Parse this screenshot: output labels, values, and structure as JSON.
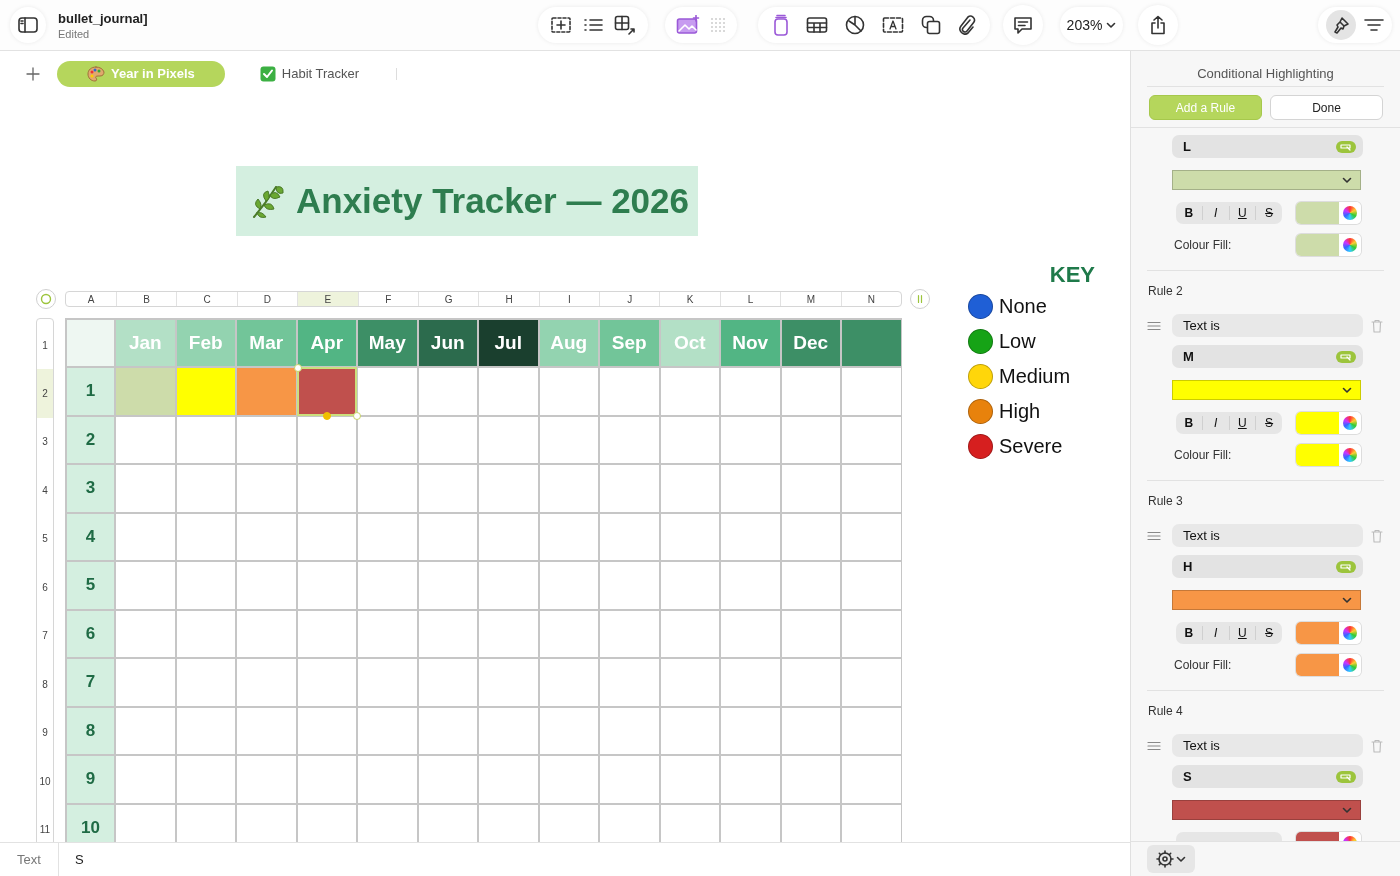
{
  "document": {
    "title": "bullet_journal]",
    "status": "Edited"
  },
  "toolbar": {
    "zoom": "203%"
  },
  "sheet_tabs": [
    {
      "label": "Year in Pixels",
      "selected": true,
      "kind": "palette"
    },
    {
      "label": "Habit Tracker",
      "selected": false,
      "kind": "check"
    }
  ],
  "banner": {
    "title": "Anxiety Tracker — 2026"
  },
  "table": {
    "column_letters": [
      "A",
      "B",
      "C",
      "D",
      "E",
      "F",
      "G",
      "H",
      "I",
      "J",
      "K",
      "L",
      "M",
      "N"
    ],
    "row_numbers": [
      "1",
      "2",
      "3",
      "4",
      "5",
      "6",
      "7",
      "8",
      "9",
      "10",
      "11"
    ],
    "header_cells": [
      {
        "color": "#eef7f2"
      },
      {
        "label": "Jan",
        "color": "#b3e0c6"
      },
      {
        "label": "Feb",
        "color": "#93d3b0"
      },
      {
        "label": "Mar",
        "color": "#72c599"
      },
      {
        "label": "Apr",
        "color": "#52b584"
      },
      {
        "label": "May",
        "color": "#3d8f66"
      },
      {
        "label": "Jun",
        "color": "#2c6b4d"
      },
      {
        "label": "Jul",
        "color": "#1a3f2e"
      },
      {
        "label": "Aug",
        "color": "#93d3b0"
      },
      {
        "label": "Sep",
        "color": "#72c599"
      },
      {
        "label": "Oct",
        "color": "#b3e0c6"
      },
      {
        "label": "Nov",
        "color": "#52b584"
      },
      {
        "label": "Dec",
        "color": "#3d8f66"
      },
      {
        "color": "#3d8f66"
      }
    ],
    "rows": [
      {
        "day": "1",
        "cells": [
          {
            "color": "#cddcaa",
            "selected": false
          },
          {
            "color": "#ffff00",
            "selected": false
          },
          {
            "color": "#f79646",
            "selected": false
          },
          {
            "color": "#c0504d",
            "selected": true
          }
        ]
      },
      {
        "day": "2"
      },
      {
        "day": "3"
      },
      {
        "day": "4"
      },
      {
        "day": "5"
      },
      {
        "day": "6"
      },
      {
        "day": "7"
      },
      {
        "day": "8"
      },
      {
        "day": "9"
      },
      {
        "day": "10"
      }
    ]
  },
  "key": {
    "title": "KEY",
    "items": [
      {
        "label": "None",
        "color": "#1f5fd6"
      },
      {
        "label": "Low",
        "color": "#16a316"
      },
      {
        "label": "Medium",
        "color": "#ffd60a"
      },
      {
        "label": "High",
        "color": "#e8820c"
      },
      {
        "label": "Severe",
        "color": "#d61f1f"
      }
    ]
  },
  "panel": {
    "title": "Conditional Highlighting",
    "add_button": "Add a Rule",
    "done_button": "Done",
    "rules": [
      {
        "value": "L",
        "color": "#cddcaa",
        "styles": [
          "B",
          "I",
          "U",
          "S"
        ],
        "fill_label": "Colour Fill:"
      },
      {
        "title": "Rule 2",
        "condition": "Text is",
        "value": "M",
        "color": "#ffff00",
        "styles": [
          "B",
          "I",
          "U",
          "S"
        ],
        "fill_label": "Colour Fill:"
      },
      {
        "title": "Rule 3",
        "condition": "Text is",
        "value": "H",
        "color": "#f79646",
        "styles": [
          "B",
          "I",
          "U",
          "S"
        ],
        "fill_label": "Colour Fill:"
      },
      {
        "title": "Rule 4",
        "condition": "Text is",
        "value": "S",
        "color": "#c0504d"
      }
    ]
  },
  "formula_bar": {
    "label": "Text",
    "value": "S"
  }
}
